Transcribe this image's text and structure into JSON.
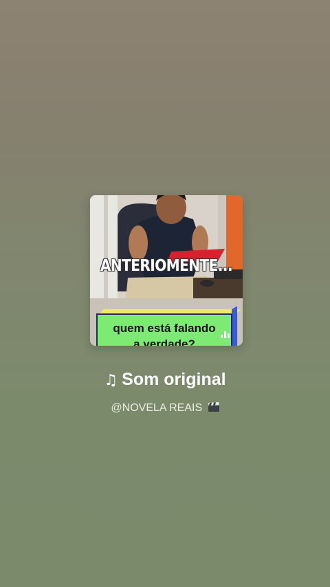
{
  "cover": {
    "overlay_text": "ANTERIOMENTE...",
    "caption_line1": "quem está falando",
    "caption_line2": "a verdade?"
  },
  "sound": {
    "note_icon": "music-note-icon",
    "title": "Som original",
    "author": "@NOVELA REAIS",
    "author_emoji_icon": "clapper-board-icon"
  }
}
